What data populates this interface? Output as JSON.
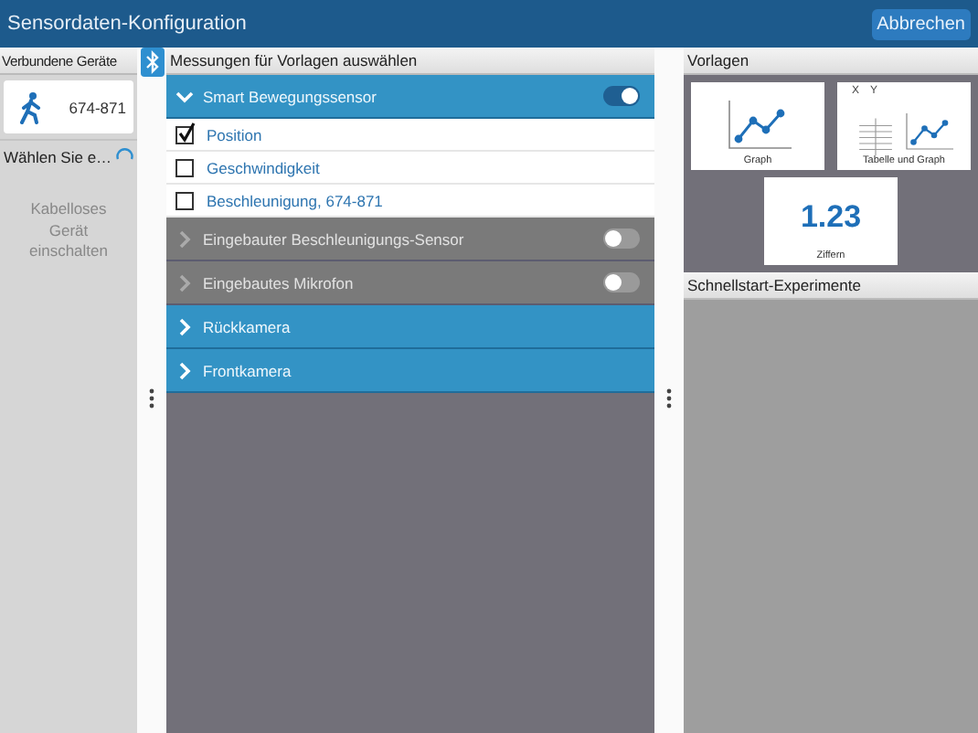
{
  "window": {
    "title": "Sensordaten-Konfiguration",
    "cancel_button": "Abbrechen"
  },
  "devices": {
    "title": "Verbundene Geräte",
    "items": [
      {
        "name": "674-871",
        "selected": true
      }
    ],
    "choose_label": "Wählen Sie e…",
    "busy": true,
    "hint": "Kabelloses Gerät einschalten"
  },
  "measurements": {
    "title": "Messungen für Vorlagen auswählen",
    "sensors": [
      {
        "name": "Smart Bewegungssensor",
        "available": true,
        "expanded": true,
        "switch": {
          "on": true
        },
        "children": [
          {
            "name": "Position",
            "checked": true
          },
          {
            "name": "Geschwindigkeit",
            "checked": false
          },
          {
            "name": "Beschleunigung, 674-871",
            "checked": false
          }
        ]
      },
      {
        "name": "Eingebauter Beschleunigungs-Sensor",
        "available": false,
        "expanded": false,
        "switch": {
          "on": false
        }
      },
      {
        "name": "Eingebautes Mikrofon",
        "available": false,
        "expanded": false,
        "switch": {
          "on": false
        }
      },
      {
        "name": "Rückkamera",
        "available": true,
        "expanded": false
      },
      {
        "name": "Frontkamera",
        "available": true,
        "expanded": false
      }
    ]
  },
  "templates": {
    "title": "Vorlagen",
    "items": [
      {
        "kind": "graph",
        "label": "Graph"
      },
      {
        "kind": "table_graph",
        "label": "Tabelle und Graph",
        "columns": [
          "X",
          "Y"
        ]
      },
      {
        "kind": "digits",
        "label": "Ziffern",
        "value": "1.23"
      }
    ]
  },
  "quick_start": {
    "title": "Schnellstart-Experimente"
  }
}
